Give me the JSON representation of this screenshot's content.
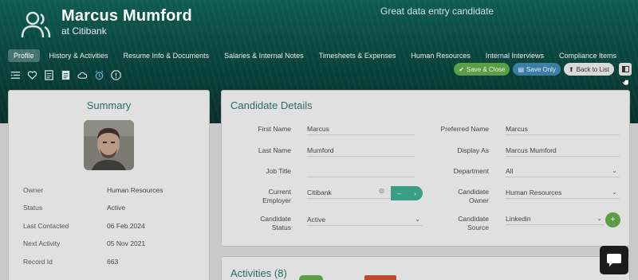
{
  "header": {
    "name": "Marcus Mumford",
    "company": "at Citibank",
    "tagline": "Great data entry candidate"
  },
  "tabs": [
    {
      "label": "Profile",
      "active": true
    },
    {
      "label": "History & Activities"
    },
    {
      "label": "Resume Info & Documents"
    },
    {
      "label": "Salaries & Internal Notes"
    },
    {
      "label": "Timesheets & Expenses"
    },
    {
      "label": "Human Resources"
    },
    {
      "label": "Internal Interviews"
    },
    {
      "label": "Compliance Items"
    }
  ],
  "toolbar_icons": [
    "list-icon",
    "heart-icon",
    "document-icon",
    "document-filled-icon",
    "cloud-icon",
    "alarm-icon",
    "alert-icon"
  ],
  "actions": {
    "save_close": "Save & Close",
    "save_only": "Save Only",
    "back": "Back to List"
  },
  "summary": {
    "title": "Summary",
    "rows": [
      {
        "key": "Owner",
        "value": "Human Resources"
      },
      {
        "key": "Status",
        "value": "Active"
      },
      {
        "key": "Last Contacted",
        "value": "06 Feb 2024"
      },
      {
        "key": "Next Activity",
        "value": "05 Nov 2021"
      },
      {
        "key": "Record Id",
        "value": "663"
      }
    ]
  },
  "details": {
    "title": "Candidate Details",
    "first_name_label": "First Name",
    "first_name": "Marcus",
    "preferred_name_label": "Preferred Name",
    "preferred_name": "Marcus",
    "last_name_label": "Last Name",
    "last_name": "Mumford",
    "display_as_label": "Display As",
    "display_as": "Marcus Mumford",
    "job_title_label": "Job Title",
    "job_title": "",
    "department_label": "Department",
    "department": "All",
    "employer_label_1": "Current",
    "employer_label_2": "Employer",
    "employer": "Citibank",
    "owner_label_1": "Candidate",
    "owner_label_2": "Owner",
    "owner": "Human Resources",
    "status_label_1": "Candidate",
    "status_label_2": "Status",
    "status": "Active",
    "source_label_1": "Candidate",
    "source_label_2": "Source",
    "source": "Linkedin"
  },
  "activities": {
    "title": "Activities (8)"
  },
  "colors": {
    "accent": "#2c6d63",
    "header": "#0a4a42",
    "green_button": "#5a9e46",
    "blue_button": "#3c7fa5"
  }
}
